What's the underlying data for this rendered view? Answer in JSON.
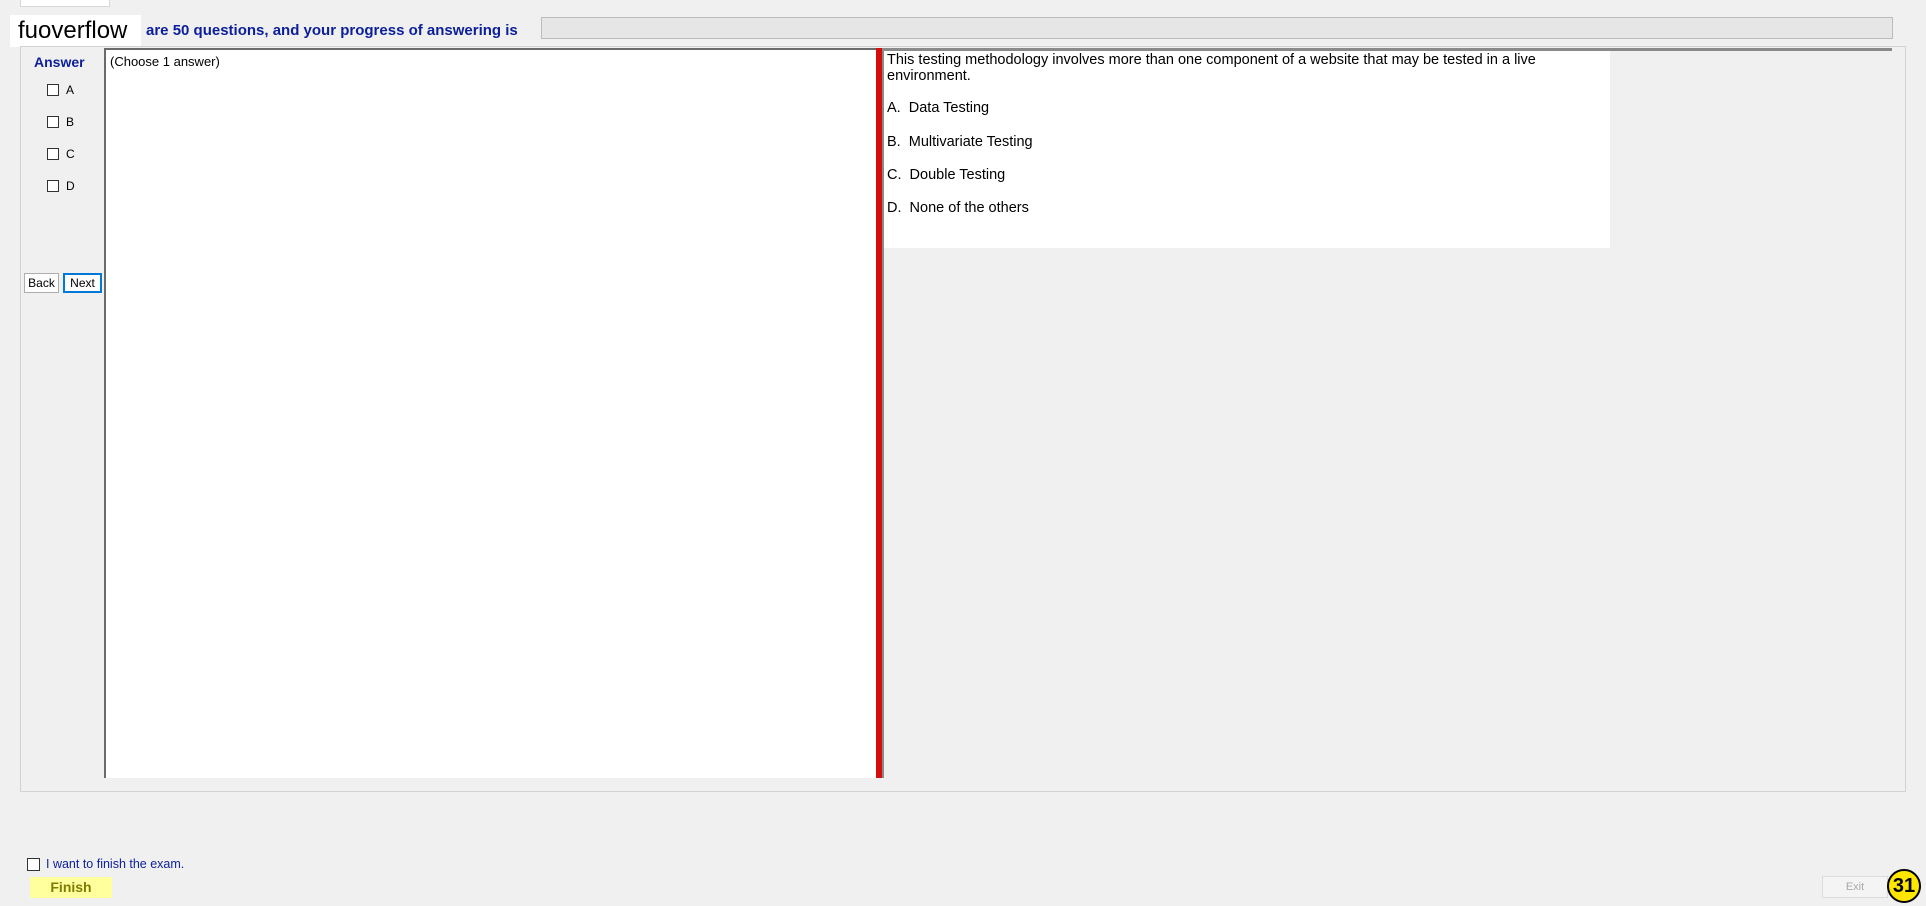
{
  "header": {
    "brand": "fuoverflow",
    "progress_text": "are 50 questions, and your progress of answering is",
    "progress_fraction": 0
  },
  "answer_panel": {
    "title": "Answer",
    "options": [
      "A",
      "B",
      "C",
      "D"
    ],
    "back_label": "Back",
    "next_label": "Next"
  },
  "left_pane": {
    "hint": "(Choose 1 answer)"
  },
  "question": {
    "text": "This testing methodology involves more than one component of a website that may be tested in a live environment.",
    "options": [
      "A.  Data Testing",
      "B.  Multivariate Testing",
      "C.  Double Testing",
      "D.  None of the others"
    ]
  },
  "footer": {
    "finish_check_label": "I want to finish the exam.",
    "finish_label": "Finish",
    "exit_label": "Exit",
    "badge_number": "31"
  }
}
